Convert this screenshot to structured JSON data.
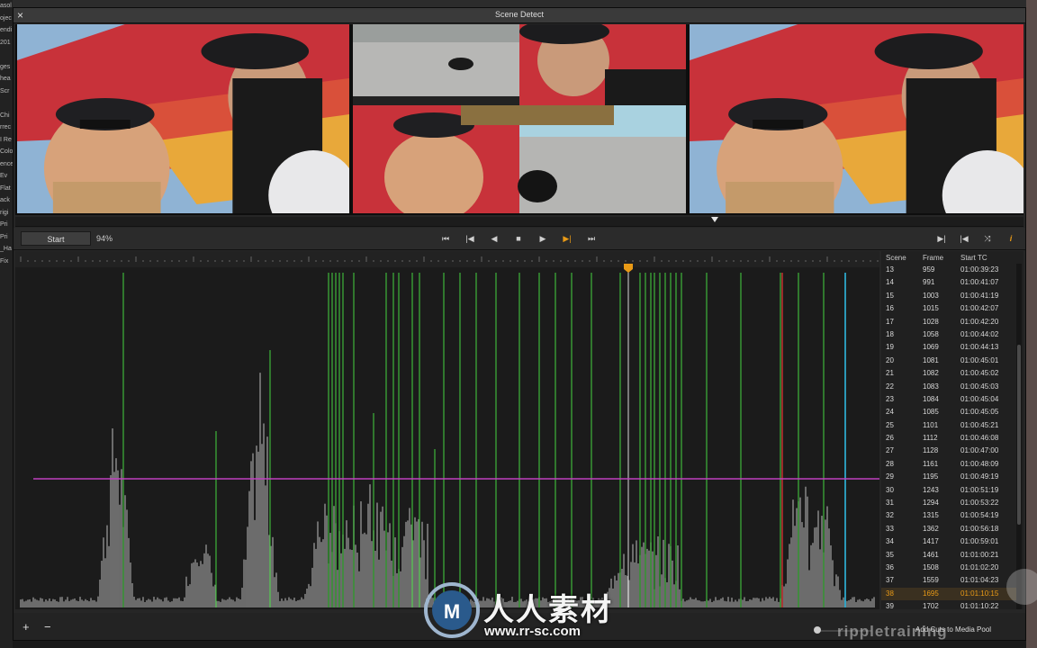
{
  "background": {
    "left_fragments": [
      "asol",
      "ojec",
      "endi",
      "201",
      "",
      "ges",
      "hea",
      "Scr",
      "",
      "Chi",
      "rrec",
      "I Re",
      "Colo",
      "ence",
      "Ev",
      "Flat",
      "ack",
      "rigi",
      "Pri",
      "Pri",
      "_Ha",
      "Fix"
    ]
  },
  "dialog": {
    "title": "Scene Detect",
    "close_label": "×"
  },
  "toolbar": {
    "start_label": "Start",
    "percent": "94%",
    "buttons": {
      "go_start": "⏮",
      "prev_cut": "|◀",
      "back": "◀",
      "stop": "■",
      "play": "▶",
      "next_cut": "▶|",
      "go_end": "⏭",
      "mark_in": "▶|",
      "mark_out": "|◀",
      "mix": "⤨",
      "info": "i"
    }
  },
  "scene_list": {
    "headers": {
      "scene": "Scene",
      "frame": "Frame",
      "start_tc": "Start TC"
    },
    "rows": [
      {
        "scene": "13",
        "frame": "959",
        "tc": "01:00:39:23"
      },
      {
        "scene": "14",
        "frame": "991",
        "tc": "01:00:41:07"
      },
      {
        "scene": "15",
        "frame": "1003",
        "tc": "01:00:41:19"
      },
      {
        "scene": "16",
        "frame": "1015",
        "tc": "01:00:42:07"
      },
      {
        "scene": "17",
        "frame": "1028",
        "tc": "01:00:42:20"
      },
      {
        "scene": "18",
        "frame": "1058",
        "tc": "01:00:44:02"
      },
      {
        "scene": "19",
        "frame": "1069",
        "tc": "01:00:44:13"
      },
      {
        "scene": "20",
        "frame": "1081",
        "tc": "01:00:45:01"
      },
      {
        "scene": "21",
        "frame": "1082",
        "tc": "01:00:45:02"
      },
      {
        "scene": "22",
        "frame": "1083",
        "tc": "01:00:45:03"
      },
      {
        "scene": "23",
        "frame": "1084",
        "tc": "01:00:45:04"
      },
      {
        "scene": "24",
        "frame": "1085",
        "tc": "01:00:45:05"
      },
      {
        "scene": "25",
        "frame": "1101",
        "tc": "01:00:45:21"
      },
      {
        "scene": "26",
        "frame": "1112",
        "tc": "01:00:46:08"
      },
      {
        "scene": "27",
        "frame": "1128",
        "tc": "01:00:47:00"
      },
      {
        "scene": "28",
        "frame": "1161",
        "tc": "01:00:48:09"
      },
      {
        "scene": "29",
        "frame": "1195",
        "tc": "01:00:49:19"
      },
      {
        "scene": "30",
        "frame": "1243",
        "tc": "01:00:51:19"
      },
      {
        "scene": "31",
        "frame": "1294",
        "tc": "01:00:53:22"
      },
      {
        "scene": "32",
        "frame": "1315",
        "tc": "01:00:54:19"
      },
      {
        "scene": "33",
        "frame": "1362",
        "tc": "01:00:56:18"
      },
      {
        "scene": "34",
        "frame": "1417",
        "tc": "01:00:59:01"
      },
      {
        "scene": "35",
        "frame": "1461",
        "tc": "01:01:00:21"
      },
      {
        "scene": "36",
        "frame": "1508",
        "tc": "01:01:02:20"
      },
      {
        "scene": "37",
        "frame": "1559",
        "tc": "01:01:04:23"
      },
      {
        "scene": "38",
        "frame": "1695",
        "tc": "01:01:10:15",
        "selected": true
      },
      {
        "scene": "39",
        "frame": "1702",
        "tc": "01:01:10:22"
      }
    ]
  },
  "footer": {
    "add_label": "+",
    "remove_label": "−",
    "add_cuts_label": "Add Cuts to Media Pool"
  },
  "watermarks": {
    "cn_text": "人人素材",
    "url": "www.rr-sc.com",
    "ripple": "rippletraining"
  },
  "colors": {
    "accent": "#e99a16",
    "cut_green": "#3fb53a",
    "threshold_magenta": "#c040c0",
    "cut_red": "#d03030",
    "cut_cyan": "#30b8e0"
  }
}
